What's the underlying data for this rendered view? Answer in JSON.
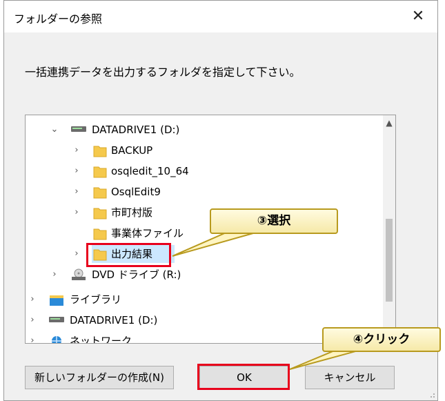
{
  "dialog": {
    "title": "フォルダーの参照",
    "close_label": "✕",
    "instruction": "一括連携データを出力するフォルダを指定して下さい。"
  },
  "tree": {
    "rows": [
      {
        "label": "DATADRIVE1 (D:)",
        "chevron": "⌄",
        "icon": "drive-icon"
      },
      {
        "label": "BACKUP",
        "chevron": "›",
        "icon": "folder-icon"
      },
      {
        "label": "osqledit_10_64",
        "chevron": "›",
        "icon": "folder-icon"
      },
      {
        "label": "OsqlEdit9",
        "chevron": "›",
        "icon": "folder-icon"
      },
      {
        "label": "市町村版",
        "chevron": "›",
        "icon": "folder-icon"
      },
      {
        "label": "事業体ファイル",
        "chevron": "",
        "icon": "folder-icon"
      },
      {
        "label": "出力結果",
        "chevron": "›",
        "icon": "folder-icon",
        "selected": true
      },
      {
        "label": "DVD ドライブ (R:)",
        "chevron": "›",
        "icon": "dvd-drive-icon"
      },
      {
        "label": "ライブラリ",
        "chevron": "›",
        "icon": "library-icon"
      },
      {
        "label": "DATADRIVE1 (D:)",
        "chevron": "›",
        "icon": "drive-icon"
      },
      {
        "label": "ネットワーク",
        "chevron": "›",
        "icon": "network-icon"
      }
    ]
  },
  "buttons": {
    "new_folder": "新しいフォルダーの作成(N)",
    "ok": "OK",
    "cancel": "キャンセル"
  },
  "annotations": {
    "select": "③選択",
    "click": "④クリック"
  },
  "colors": {
    "highlight": "#e8001c",
    "callout_border": "#b89a1e",
    "folder": "#f5c94c"
  }
}
